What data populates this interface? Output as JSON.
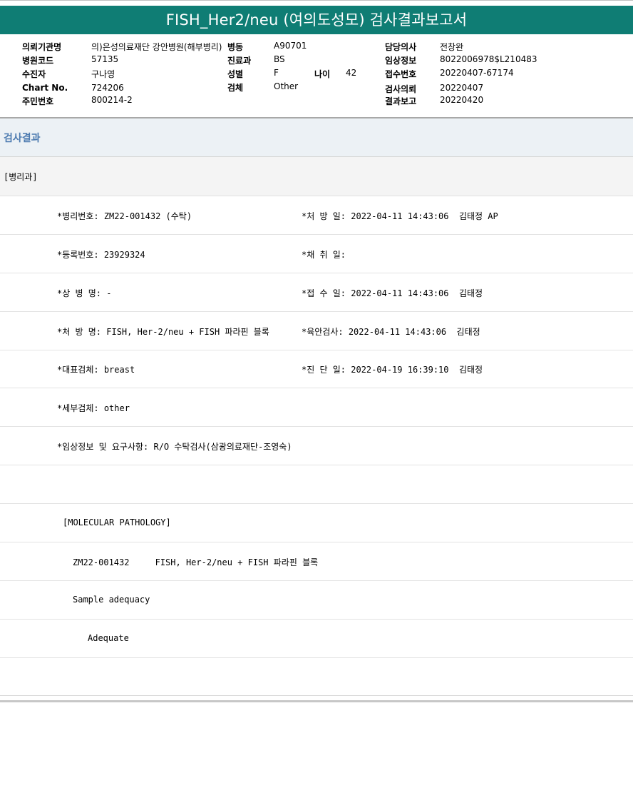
{
  "title": "FISH_Her2/neu (여의도성모) 검사결과보고서",
  "info": {
    "institution_label": "의뢰기관명",
    "institution_value": "의)은성의료재단 강안병원(해부병리)",
    "ward_label": "병동",
    "ward_value": "A90701",
    "doctor_label": "담당의사",
    "doctor_value": "전창완",
    "hospital_code_label": "병원코드",
    "hospital_code_value": "57135",
    "dept_label": "진료과",
    "dept_value": "BS",
    "clinical_label": "임상정보",
    "clinical_value": "8022006978$L210483",
    "recipient_label": "수진자",
    "recipient_value": "구나영",
    "sex_label": "성별",
    "sex_value": "F",
    "age_label": "나이",
    "age_value": "42",
    "receipt_label": "접수번호",
    "receipt_value": "20220407-67174",
    "chart_label": "Chart No.",
    "chart_value": "724206",
    "specimen_label": "검체",
    "specimen_value": "Other",
    "request_label": "검사의뢰",
    "request_value": "20220407",
    "resident_label": "주민번호",
    "resident_value": "800214-2",
    "report_label": "결과보고",
    "report_value": "20220420"
  },
  "results": {
    "header": "검사결과",
    "department": "[병리과]",
    "rows": [
      {
        "left": "*병리번호: ZM22-001432 (수탁)",
        "right": "*처 방 일: 2022-04-11 14:43:06  김태정 AP"
      },
      {
        "left": "*등록번호: 23929324",
        "right": "*채 취 일:"
      },
      {
        "left": "*상 병 명: -",
        "right": "*접 수 일: 2022-04-11 14:43:06  김태정"
      },
      {
        "left": "*처 방 명: FISH, Her-2/neu + FISH 파라핀 블록",
        "right": "*육안검사: 2022-04-11 14:43:06  김태정"
      },
      {
        "left": "*대표검체: breast",
        "right": "*진 단 일: 2022-04-19 16:39:10  김태정"
      },
      {
        "left": "*세부검체: other",
        "right": ""
      },
      {
        "left": "*임상정보 및 요구사항: R/O 수탁검사(삼광의료재단-조영숙)",
        "right": ""
      }
    ],
    "molecular_heading": "[MOLECULAR PATHOLOGY]",
    "molecular_line": "ZM22-001432     FISH, Her-2/neu + FISH 파라핀 블록",
    "sample_adequacy": "Sample adequacy",
    "adequate": "Adequate"
  }
}
